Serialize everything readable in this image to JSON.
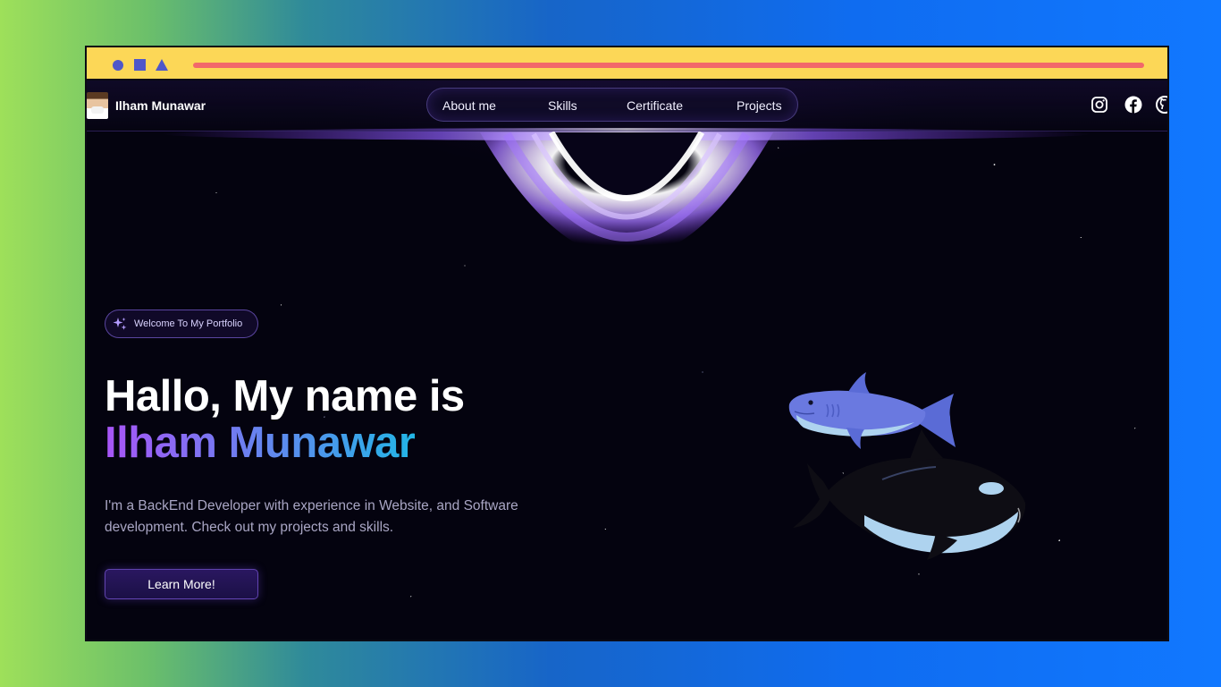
{
  "nav": {
    "brand_name": "Ilham Munawar",
    "links": [
      "About me",
      "Skills",
      "Certificate",
      "Projects"
    ],
    "social_icons": [
      "instagram-icon",
      "facebook-icon",
      "github-icon"
    ]
  },
  "hero": {
    "badge_text": "Welcome To My Portfolio",
    "title_line1": "Hallo, My name is",
    "title_line2": "Ilham Munawar",
    "description": "I'm a BackEnd Developer with experience in Website, and Software development. Check out my projects and skills.",
    "cta_label": "Learn More!"
  },
  "colors": {
    "frame_bar": "#fcd757",
    "frame_shapes": "#4f57c9",
    "address_line": "#f2686a",
    "page_background": "#04030f",
    "accent_purple": "#a855f7",
    "accent_cyan": "#22b6e6"
  }
}
